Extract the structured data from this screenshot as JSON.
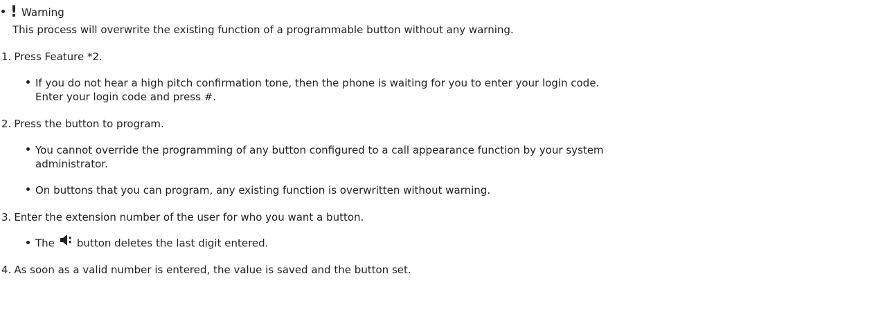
{
  "warning": {
    "icon": "exclamation-icon",
    "title": "Warning",
    "text": "This process will overwrite the existing function of a programmable button without any warning."
  },
  "steps": [
    {
      "number": "1.",
      "text": "Press Feature *2.",
      "bullets": [
        "If you do not hear a high pitch confirmation tone, then the phone is waiting for you to enter your login code.",
        "Enter your login code and press #."
      ]
    },
    {
      "number": "2.",
      "text": "Press the button to program.",
      "bullets": [
        "You cannot override the programming of any button configured to a call appearance function by your system",
        "administrator.",
        "On buttons that you can program, any existing function is overwritten without warning."
      ]
    },
    {
      "number": "3.",
      "text": "Enter the extension number of the user for who you want a button.",
      "bullets": [
        "The",
        "button deletes the last digit entered."
      ],
      "inline_icon": "speaker-delete-icon"
    },
    {
      "number": "4.",
      "text": "As soon as a valid number is entered, the value is saved and the button set."
    }
  ]
}
